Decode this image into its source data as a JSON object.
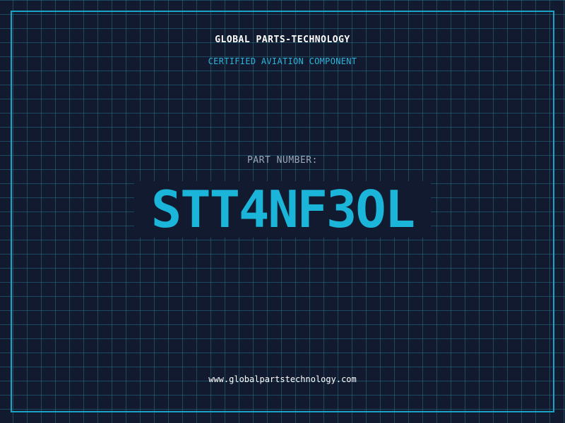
{
  "header": {
    "company_name": "GLOBAL PARTS-TECHNOLOGY",
    "tagline": "CERTIFIED AVIATION COMPONENT"
  },
  "part": {
    "label": "PART NUMBER:",
    "number": "STT4NF3OL"
  },
  "footer": {
    "url": "www.globalpartstechnology.com"
  },
  "colors": {
    "background": "#111a2e",
    "grid": "#286e82",
    "accent": "#1ab5d8",
    "frame": "#1aa4c8",
    "label": "#9aa8bb",
    "text": "#ffffff"
  }
}
